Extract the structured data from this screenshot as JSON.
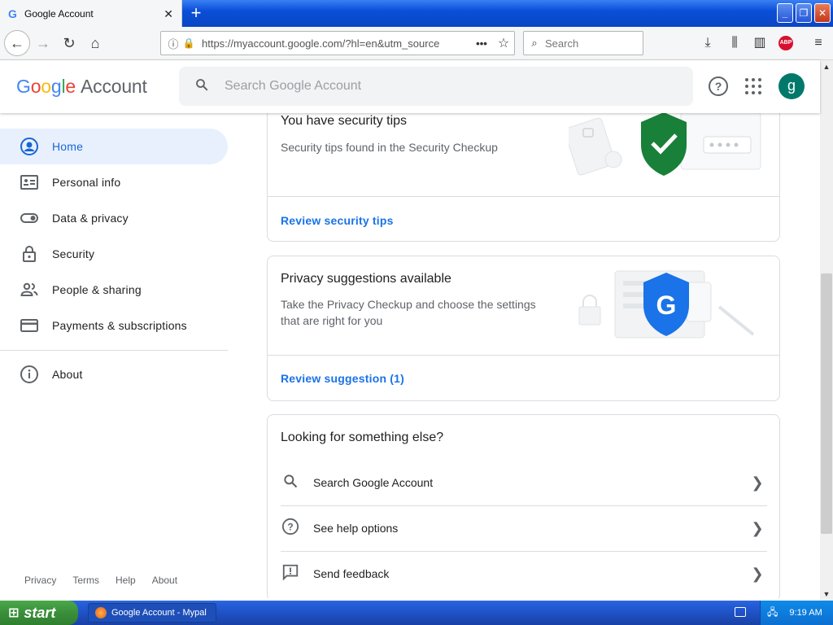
{
  "browser": {
    "tab_title": "Google Account",
    "tab_favicon": "G",
    "url": "https://myaccount.google.com/?hl=en&utm_source",
    "search_placeholder": "Search",
    "abp_label": "ABP"
  },
  "header": {
    "logo_letters": [
      "G",
      "o",
      "o",
      "g",
      "l",
      "e"
    ],
    "logo_product": "Account",
    "search_placeholder": "Search Google Account",
    "avatar_letter": "g"
  },
  "sidebar": {
    "items": [
      {
        "label": "Home",
        "icon": "account-circle-icon"
      },
      {
        "label": "Personal info",
        "icon": "id-card-icon"
      },
      {
        "label": "Data & privacy",
        "icon": "toggle-icon"
      },
      {
        "label": "Security",
        "icon": "lock-icon"
      },
      {
        "label": "People & sharing",
        "icon": "people-icon"
      },
      {
        "label": "Payments & subscriptions",
        "icon": "credit-card-icon"
      }
    ],
    "about_label": "About",
    "footer": [
      "Privacy",
      "Terms",
      "Help",
      "About"
    ]
  },
  "cards": {
    "security": {
      "title": "You have security tips",
      "desc": "Security tips found in the Security Checkup",
      "link": "Review security tips"
    },
    "privacy": {
      "title": "Privacy suggestions available",
      "desc": "Take the Privacy Checkup and choose the settings that are right for you",
      "link": "Review suggestion (1)"
    },
    "else": {
      "title": "Looking for something else?",
      "rows": [
        "Search Google Account",
        "See help options",
        "Send feedback"
      ]
    }
  },
  "taskbar": {
    "start_label": "start",
    "task_label": "Google Account - Mypal",
    "clock": "9:19 AM"
  },
  "colors": {
    "accent_blue": "#1a73e8",
    "active_bg": "#e8f0fe",
    "shield_green": "#188038",
    "shield_blue": "#1a73e8",
    "avatar": "#00796b"
  }
}
